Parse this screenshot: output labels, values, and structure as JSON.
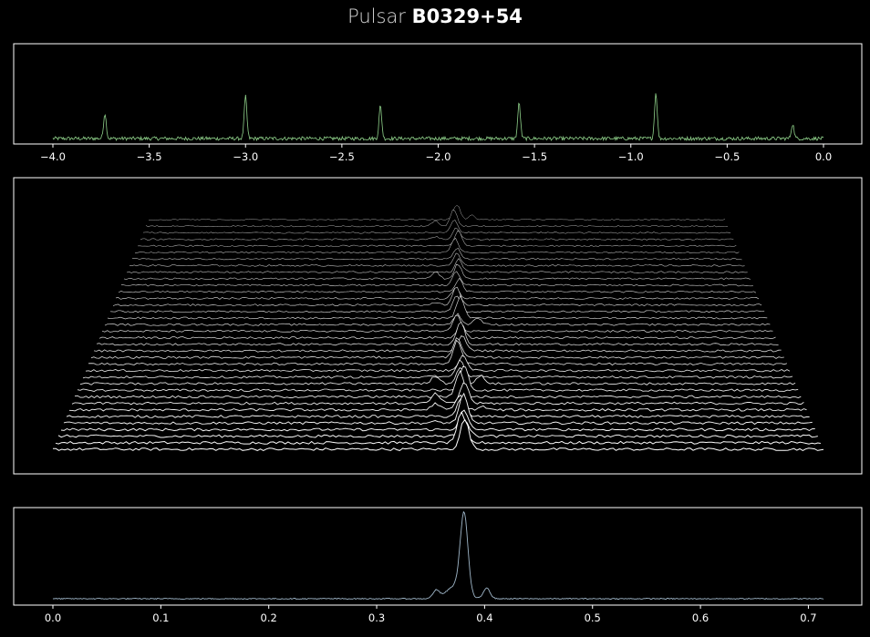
{
  "title": {
    "prefix": "Pulsar",
    "name": "B0329+54"
  },
  "colors": {
    "top_series": "#8fd18a",
    "stack_lines": "#ffffff",
    "avg_profile": "#9fb6c8",
    "frame": "#ffffff",
    "background": "#000000"
  },
  "chart_data": [
    {
      "type": "line",
      "panel": "time-series",
      "xlim": [
        -4.0,
        0.0
      ],
      "xticks": [
        "-4.0",
        "-3.5",
        "-3.0",
        "-2.5",
        "-2.0",
        "-1.5",
        "-1.0",
        "-0.5",
        "0.0"
      ],
      "pulse_times": [
        -3.73,
        -3.0,
        -2.3,
        -1.58,
        -0.87,
        -0.16
      ],
      "pulse_heights": [
        0.55,
        0.92,
        0.72,
        0.78,
        1.0,
        0.32
      ],
      "noise_level": 0.05,
      "grid": false,
      "axes": false
    },
    {
      "type": "line",
      "panel": "stacked-pulses",
      "n_pulses": 36,
      "xlim": [
        0.0,
        0.714
      ],
      "peak_phase": 0.38,
      "secondary_phases": [
        0.355,
        0.4
      ],
      "grid": false
    },
    {
      "type": "line",
      "panel": "integrated-profile",
      "xlim": [
        0.0,
        0.714
      ],
      "xticks": [
        "0.0",
        "0.1",
        "0.2",
        "0.3",
        "0.4",
        "0.5",
        "0.6",
        "0.7"
      ],
      "peak_phase": 0.381,
      "peak_value": 1.0,
      "secondary": [
        {
          "phase": 0.355,
          "value": 0.1
        },
        {
          "phase": 0.402,
          "value": 0.14
        }
      ],
      "grid": false
    }
  ]
}
